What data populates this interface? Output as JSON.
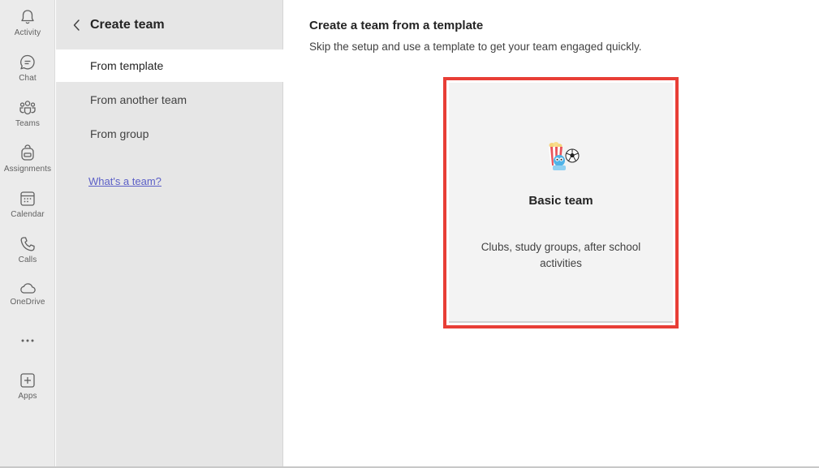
{
  "rail": {
    "items": [
      {
        "label": "Activity",
        "icon": "bell-icon"
      },
      {
        "label": "Chat",
        "icon": "chat-icon"
      },
      {
        "label": "Teams",
        "icon": "teams-icon"
      },
      {
        "label": "Assignments",
        "icon": "assignments-icon"
      },
      {
        "label": "Calendar",
        "icon": "calendar-icon"
      },
      {
        "label": "Calls",
        "icon": "phone-icon"
      },
      {
        "label": "OneDrive",
        "icon": "cloud-icon"
      },
      {
        "label": "",
        "icon": "more-icon"
      },
      {
        "label": "Apps",
        "icon": "add-apps-icon"
      }
    ]
  },
  "panel": {
    "title": "Create team",
    "nav": [
      {
        "label": "From template",
        "active": true
      },
      {
        "label": "From another team",
        "active": false
      },
      {
        "label": "From group",
        "active": false
      }
    ],
    "help_link": "What's a team?"
  },
  "main": {
    "title": "Create a team from a template",
    "subtitle": "Skip the setup and use a template to get your team engaged quickly.",
    "card": {
      "title": "Basic team",
      "description": "Clubs, study groups, after school activities",
      "icon": "basic-team-icon",
      "highlight_color": "#e83e36"
    }
  },
  "colors": {
    "accent": "#5b5fc7",
    "rail_bg": "#ebebeb",
    "panel_bg": "#e6e6e6"
  }
}
